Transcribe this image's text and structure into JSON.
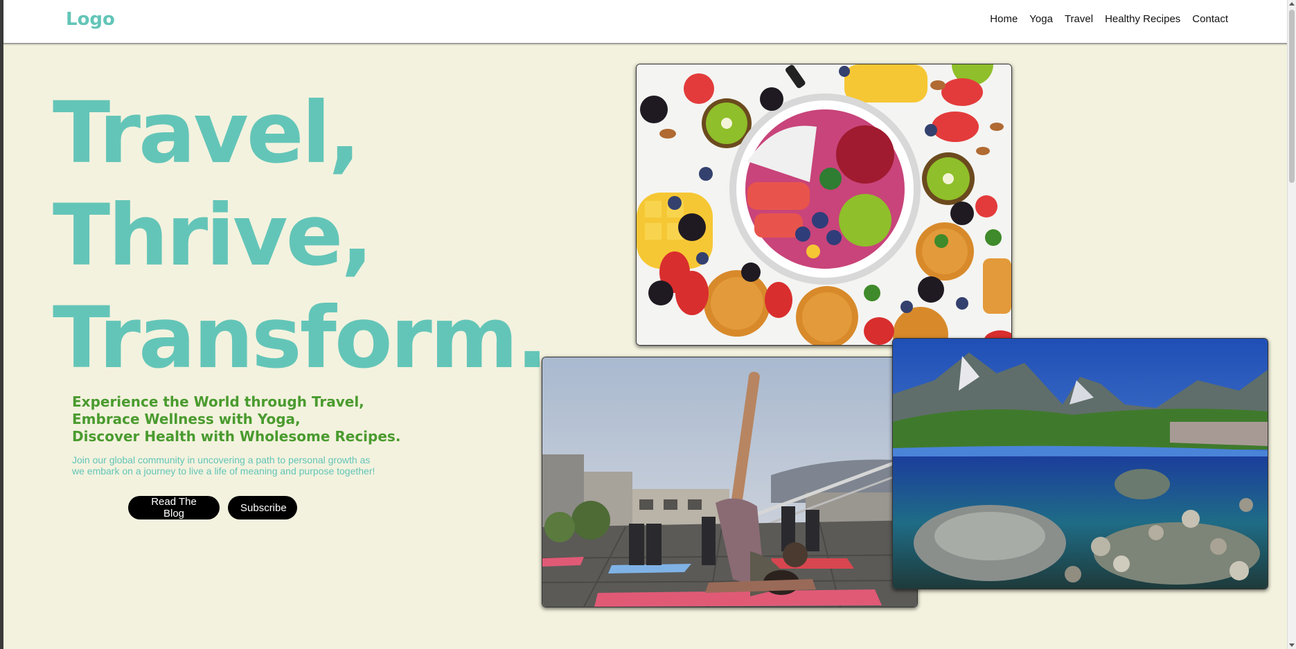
{
  "navbar": {
    "logo": "Logo",
    "links": [
      "Home",
      "Yoga",
      "Travel",
      "Healthy Recipes",
      "Contact"
    ]
  },
  "hero": {
    "title_lines": [
      "Travel,",
      "Thrive,",
      "Transform."
    ],
    "tagline_lines": [
      "Experience the World through Travel,",
      "Embrace Wellness with Yoga,",
      "Discover Health with Wholesome Recipes."
    ],
    "description_lines": [
      "Join our global community in uncovering a path to personal growth as",
      "we embark on a journey to live a life of meaning and purpose together!"
    ],
    "buttons": {
      "read_blog": "Read The Blog",
      "subscribe": "Subscribe"
    }
  },
  "images": {
    "fruit": "fruit-bowl-photo",
    "yoga": "rooftop-yoga-photo",
    "lake": "mountain-lake-photo"
  },
  "colors": {
    "background": "#f3f2de",
    "accent_teal": "#63c5b8",
    "accent_green": "#4a9b2f",
    "button_bg": "#000000"
  }
}
